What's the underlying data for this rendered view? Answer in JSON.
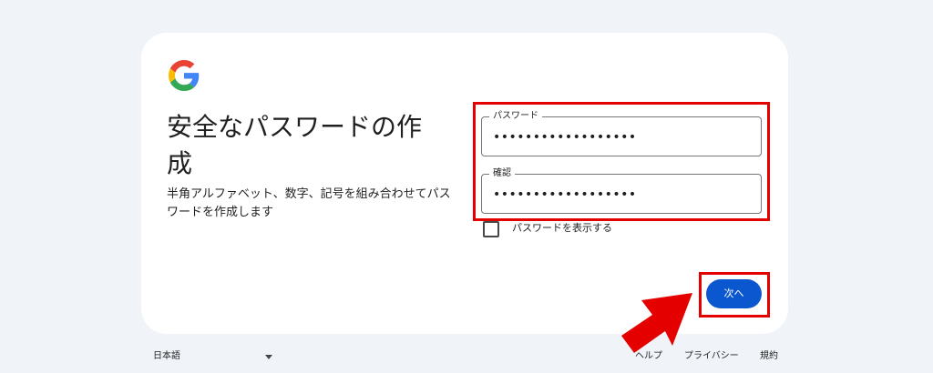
{
  "header": {
    "logo_icon": "google-g-logo"
  },
  "main": {
    "title": "安全なパスワードの作成",
    "subtitle": "半角アルファベット、数字、記号を組み合わせてパスワードを作成します"
  },
  "form": {
    "password": {
      "label": "パスワード",
      "value": "••••••••••••••••••"
    },
    "confirm": {
      "label": "確認",
      "value": "••••••••••••••••••"
    },
    "show_password": {
      "label": "パスワードを表示する",
      "checked": false
    }
  },
  "actions": {
    "next_label": "次へ"
  },
  "footer": {
    "language": "日本語",
    "help": "ヘルプ",
    "privacy": "プライバシー",
    "terms": "規約"
  },
  "colors": {
    "background": "#f0f4f9",
    "card": "#ffffff",
    "primary_button": "#0b57d0",
    "annotation_red": "#e50000"
  }
}
